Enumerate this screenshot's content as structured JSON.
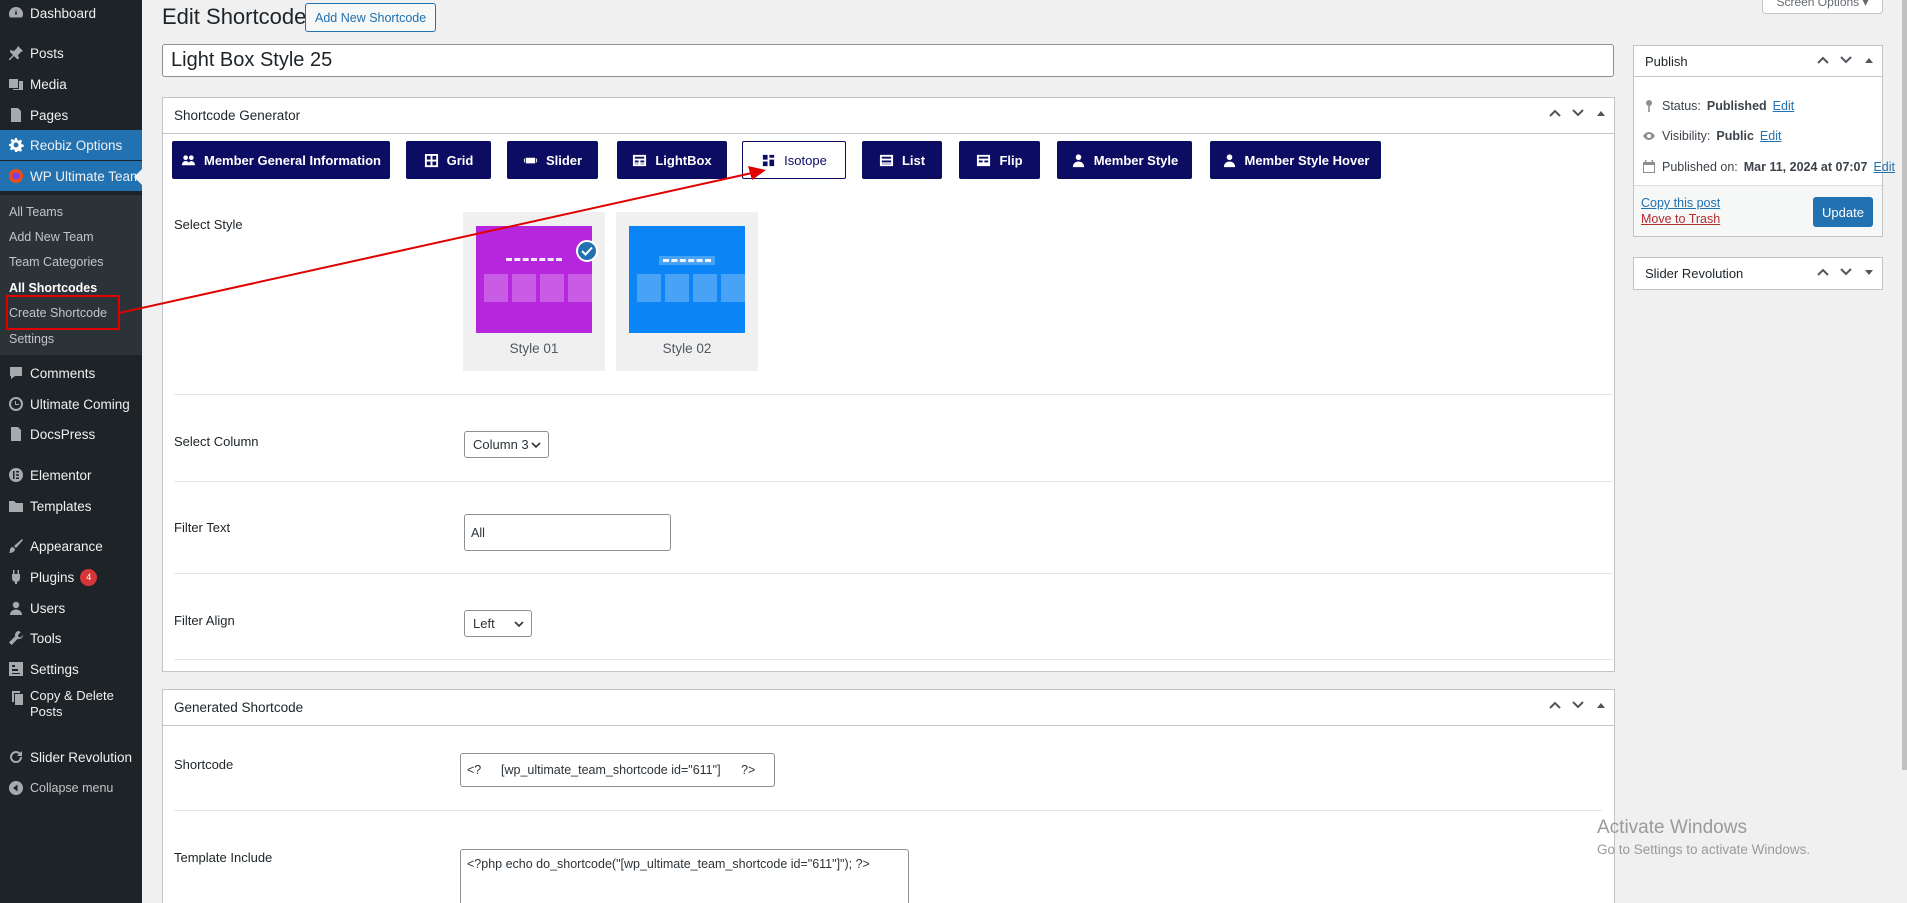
{
  "sidebar": {
    "items": [
      {
        "label": "Dashboard",
        "icon": "dashboard-icon"
      },
      {
        "label": "Posts",
        "icon": "pin-icon"
      },
      {
        "label": "Media",
        "icon": "media-icon"
      },
      {
        "label": "Pages",
        "icon": "pages-icon"
      },
      {
        "label": "Reobiz Options",
        "icon": "gear-icon"
      },
      {
        "label": "WP Ultimate Team",
        "icon": "team-plugin-icon"
      },
      {
        "label": "Comments",
        "icon": "comment-icon"
      },
      {
        "label": "Ultimate Coming",
        "icon": "clock-icon"
      },
      {
        "label": "DocsPress",
        "icon": "docs-icon"
      },
      {
        "label": "Elementor",
        "icon": "elementor-icon"
      },
      {
        "label": "Templates",
        "icon": "folder-icon"
      },
      {
        "label": "Appearance",
        "icon": "brush-icon"
      },
      {
        "label": "Plugins",
        "icon": "plugin-icon",
        "badge": "4"
      },
      {
        "label": "Users",
        "icon": "user-icon"
      },
      {
        "label": "Tools",
        "icon": "wrench-icon"
      },
      {
        "label": "Settings",
        "icon": "settings-icon"
      },
      {
        "label": "Copy & Delete",
        "label2": "Posts",
        "icon": "copy-icon"
      },
      {
        "label": "Slider Revolution",
        "icon": "refresh-icon"
      },
      {
        "label": "Collapse menu",
        "icon": "collapse-icon"
      }
    ],
    "submenu": [
      "All Teams",
      "Add New Team",
      "Team Categories",
      "All Shortcodes",
      "Create Shortcode",
      "Settings"
    ]
  },
  "header": {
    "title": "Edit Shortcode",
    "add_new": "Add New Shortcode",
    "screen_options": "Screen Options"
  },
  "post_title": "Light Box Style 25",
  "generator": {
    "title": "Shortcode Generator",
    "tabs": [
      "Member General Information",
      "Grid",
      "Slider",
      "LightBox",
      "Isotope",
      "List",
      "Flip",
      "Member Style",
      "Member Style Hover"
    ],
    "active_tab": "Isotope",
    "select_style_label": "Select Style",
    "styles": [
      {
        "name": "Style 01",
        "color": "#b626dc",
        "selected": true
      },
      {
        "name": "Style 02",
        "color": "#0b85f5",
        "selected": false
      }
    ],
    "select_column_label": "Select Column",
    "select_column_value": "Column 3",
    "filter_text_label": "Filter Text",
    "filter_text_value": "All",
    "filter_align_label": "Filter Align",
    "filter_align_value": "Left"
  },
  "generated": {
    "title": "Generated Shortcode",
    "shortcode_label": "Shortcode",
    "shortcode_open": "<?",
    "shortcode_value": "[wp_ultimate_team_shortcode id=\"611\"]",
    "shortcode_close": "?>",
    "template_label": "Template Include",
    "template_value": "<?php echo do_shortcode(\"[wp_ultimate_team_shortcode id=\"611\"]\"); ?>"
  },
  "publish": {
    "title": "Publish",
    "status_label": "Status:",
    "status_value": "Published",
    "visibility_label": "Visibility:",
    "visibility_value": "Public",
    "published_label": "Published on:",
    "published_value": "Mar 11, 2024 at 07:07",
    "edit": "Edit",
    "copy": "Copy this post",
    "trash": "Move to Trash",
    "update": "Update"
  },
  "slider_revolution": {
    "title": "Slider Revolution"
  },
  "watermark": {
    "line1": "Activate Windows",
    "line2": "Go to Settings to activate Windows."
  },
  "colors": {
    "accent": "#2271b1",
    "tab_bg": "#0c0c63",
    "annotation": "#e00000",
    "sidebar_bg": "#1d2327"
  }
}
